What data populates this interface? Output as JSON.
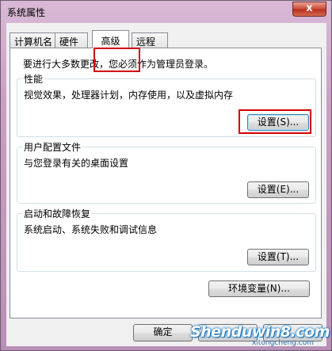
{
  "window": {
    "title": "系统属性",
    "close_label": "x"
  },
  "tabs": [
    {
      "label": "计算机名"
    },
    {
      "label": "硬件"
    },
    {
      "label": "高级"
    },
    {
      "label": "远程"
    }
  ],
  "active_tab": "高级",
  "notice": "要进行大多数更改，您必须作为管理员登录。",
  "groups": {
    "performance": {
      "title": "性能",
      "description": "视觉效果，处理器计划，内存使用，以及虚拟内存",
      "button": "设置(S)..."
    },
    "user_profiles": {
      "title": "用户配置文件",
      "description": "与您登录有关的桌面设置",
      "button": "设置(E)..."
    },
    "startup_recovery": {
      "title": "启动和故障恢复",
      "description": "系统启动、系统失败和调试信息",
      "button": "设置(T)..."
    }
  },
  "env_button": "环境变量(N)...",
  "footer": {
    "ok": "确定",
    "cancel": "",
    "apply": ""
  },
  "watermark": {
    "main": "Shenduwin8.com",
    "sub": "xitongcheng.com"
  },
  "colors": {
    "highlight": "#d40000",
    "close_button": "#c8412d",
    "focus_border": "#3c7fb1"
  }
}
